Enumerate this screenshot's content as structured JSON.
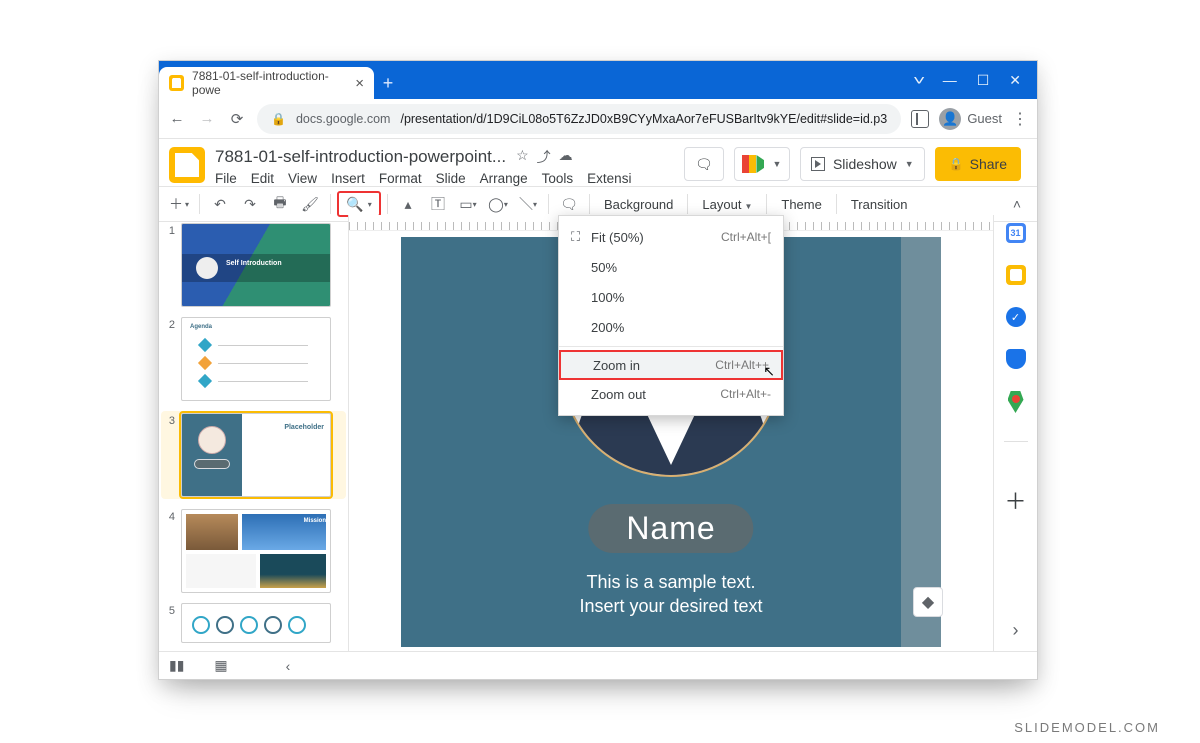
{
  "browser": {
    "tab_title": "7881-01-self-introduction-powe",
    "url_host": "docs.google.com",
    "url_path": "/presentation/d/1D9CiL08o5T6ZzJD0xB9CYyMxaAor7eFUSBarItv9kYE/edit#slide=id.p3",
    "guest_label": "Guest"
  },
  "header": {
    "doc_title": "7881-01-self-introduction-powerpoint...",
    "menus": [
      "File",
      "Edit",
      "View",
      "Insert",
      "Format",
      "Slide",
      "Arrange",
      "Tools",
      "Extensi"
    ],
    "slideshow_label": "Slideshow",
    "share_label": "Share"
  },
  "toolbar": {
    "background": "Background",
    "layout": "Layout",
    "theme": "Theme",
    "transition": "Transition"
  },
  "zoom_menu": {
    "fit": "Fit (50%)",
    "fit_short": "Ctrl+Alt+[",
    "p50": "50%",
    "p100": "100%",
    "p200": "200%",
    "zoom_in": "Zoom in",
    "zoom_in_short": "Ctrl+Alt++",
    "zoom_out": "Zoom out",
    "zoom_out_short": "Ctrl+Alt+-"
  },
  "thumbs": {
    "t1_title": "Self Introduction",
    "t2_title": "Agenda",
    "t3_title": "Placeholder",
    "t4_title": "Mission"
  },
  "slide": {
    "name_label": "Name",
    "line1": "This is a sample text.",
    "line2": "Insert your desired text"
  },
  "watermark": "SLIDEMODEL.COM"
}
